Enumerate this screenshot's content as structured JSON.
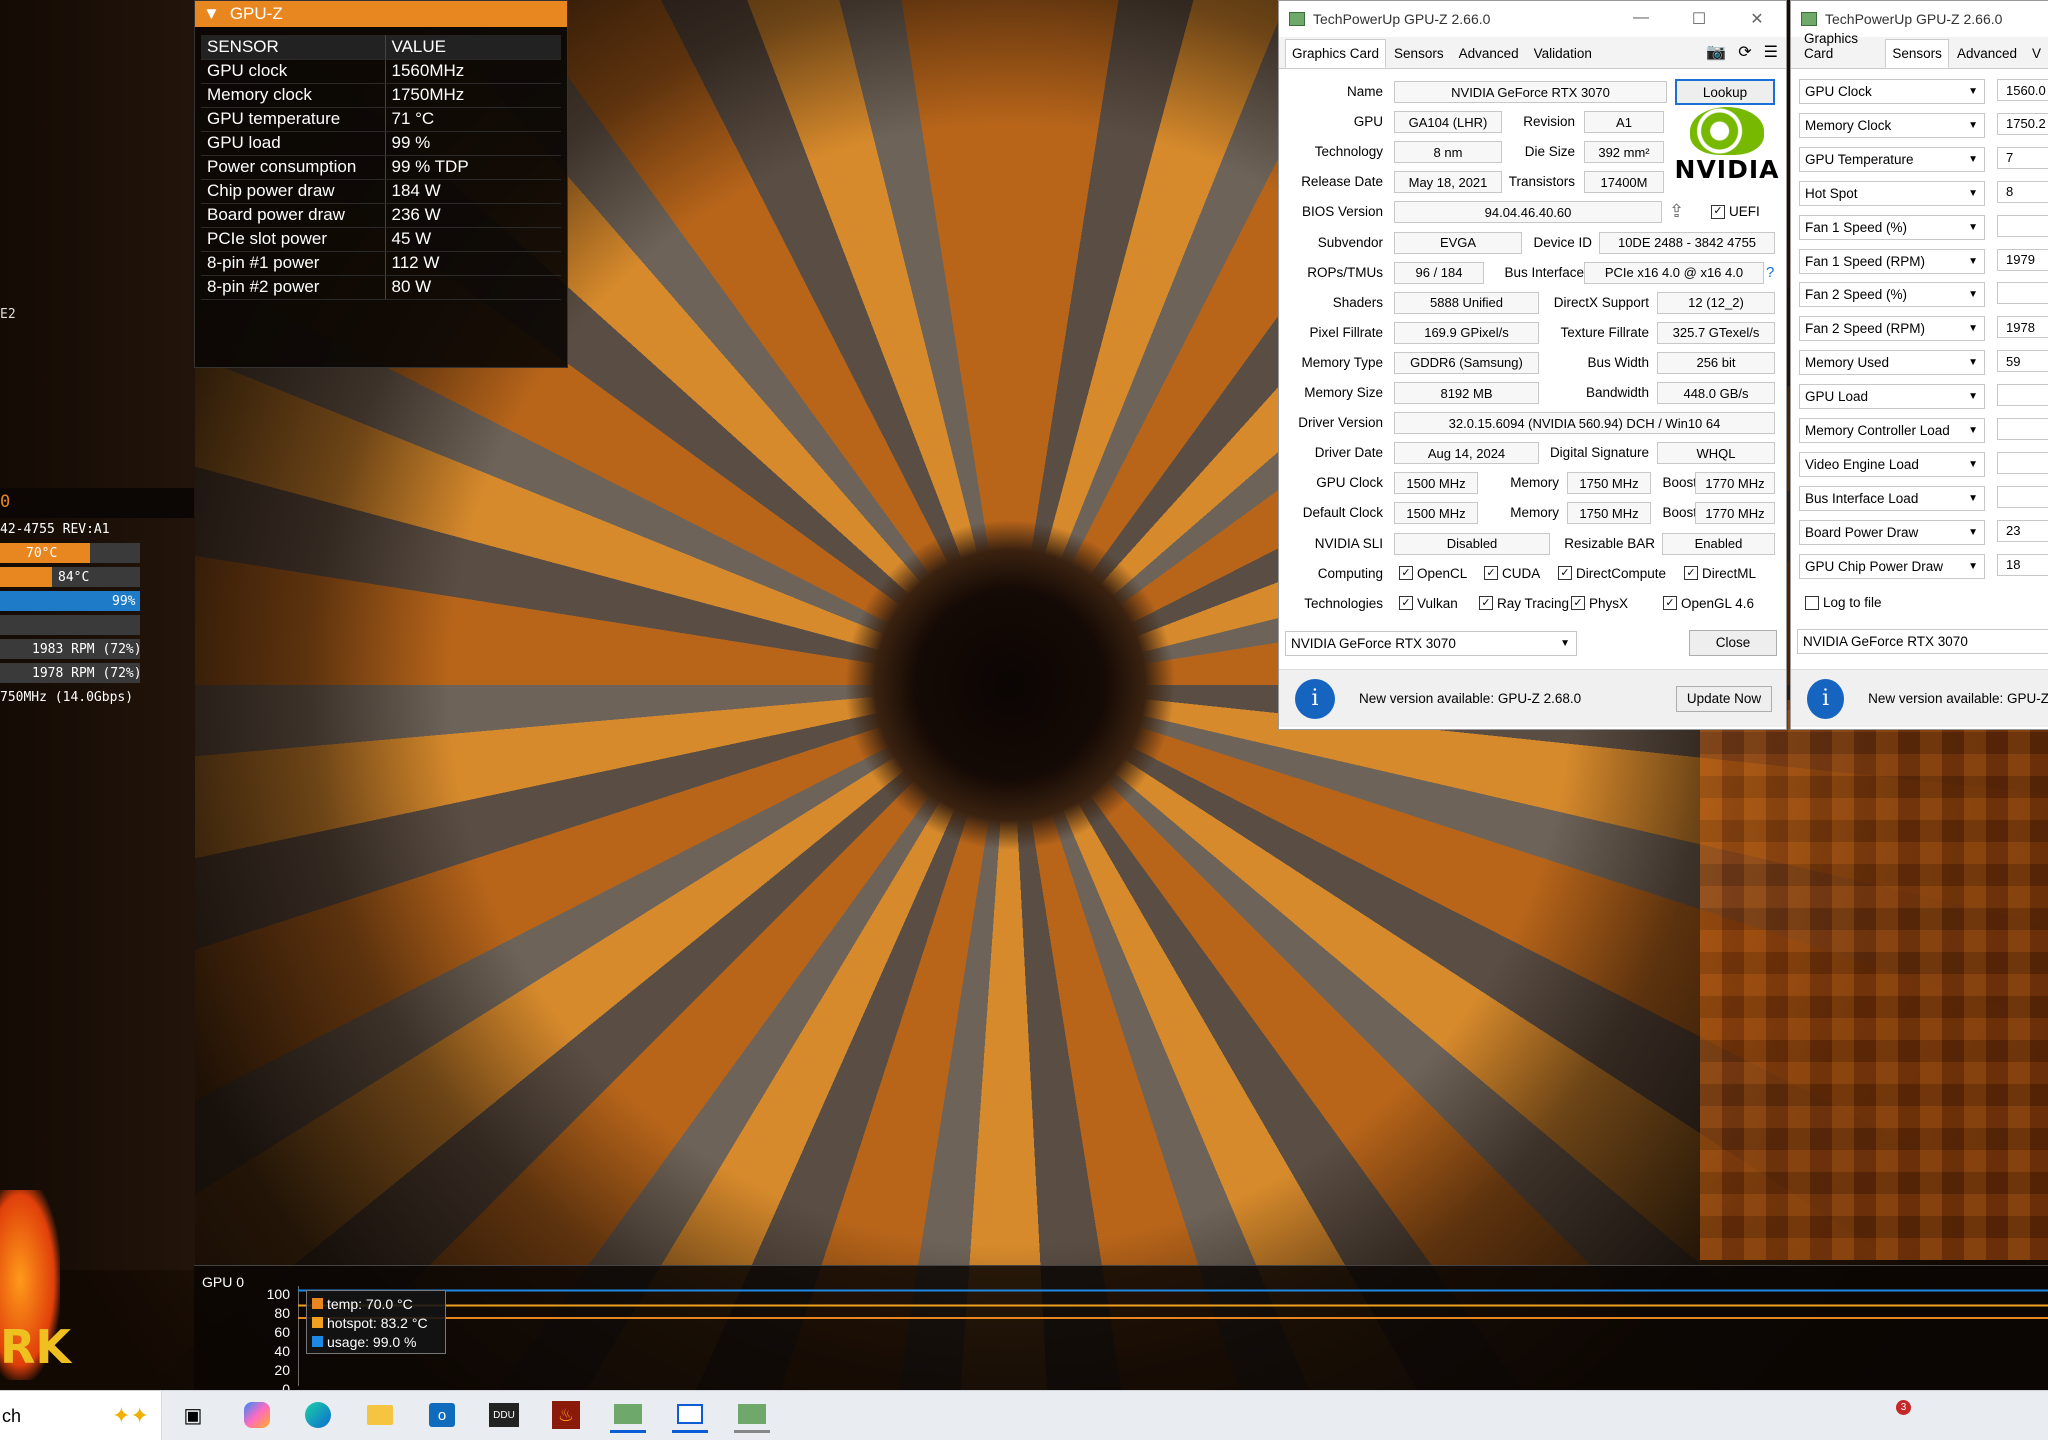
{
  "osd": {
    "title": "GPU-Z",
    "col_sensor": "SENSOR",
    "col_value": "VALUE",
    "rows": [
      {
        "sensor": "GPU clock",
        "value": "1560MHz"
      },
      {
        "sensor": "Memory clock",
        "value": "1750MHz"
      },
      {
        "sensor": "GPU temperature",
        "value": "71 °C"
      },
      {
        "sensor": "GPU load",
        "value": "99 %"
      },
      {
        "sensor": "Power consumption",
        "value": "99 % TDP"
      },
      {
        "sensor": "Chip power draw",
        "value": "184 W"
      },
      {
        "sensor": "Board power draw",
        "value": "236 W"
      },
      {
        "sensor": "PCIe slot power",
        "value": "45 W"
      },
      {
        "sensor": "8-pin #1 power",
        "value": "112 W"
      },
      {
        "sensor": "8-pin #2 power",
        "value": "80 W"
      }
    ]
  },
  "left_monitor": {
    "e2": "E2",
    "o": "0",
    "rev": "42-4755 REV:A1",
    "temp1": "70°C",
    "temp2": "84°C",
    "usage": "99%",
    "fan1": "1983 RPM (72%)",
    "fan2": "1978 RPM (72%)",
    "mem": "750MHz (14.0Gbps)",
    "bars": {
      "temp1": 0.64,
      "temp2": 0.37,
      "usage": 1.0
    }
  },
  "gpuz": {
    "title": "TechPowerUp GPU-Z 2.66.0",
    "tabs": [
      "Graphics Card",
      "Sensors",
      "Advanced",
      "Validation"
    ],
    "labels": {
      "name": "Name",
      "gpu": "GPU",
      "revision": "Revision",
      "technology": "Technology",
      "die_size": "Die Size",
      "release_date": "Release Date",
      "transistors": "Transistors",
      "bios": "BIOS Version",
      "uefi": "UEFI",
      "subvendor": "Subvendor",
      "device_id": "Device ID",
      "rops": "ROPs/TMUs",
      "bus_interface": "Bus Interface",
      "shaders": "Shaders",
      "directx": "DirectX Support",
      "pixel_fillrate": "Pixel Fillrate",
      "texture_fillrate": "Texture Fillrate",
      "memory_type": "Memory Type",
      "bus_width": "Bus Width",
      "memory_size": "Memory Size",
      "bandwidth": "Bandwidth",
      "driver_version": "Driver Version",
      "driver_date": "Driver Date",
      "digital_signature": "Digital Signature",
      "gpu_clock": "GPU Clock",
      "memory": "Memory",
      "boost": "Boost",
      "default_clock": "Default Clock",
      "sli": "NVIDIA SLI",
      "resizable_bar": "Resizable BAR",
      "computing": "Computing",
      "technologies": "Technologies"
    },
    "values": {
      "name": "NVIDIA GeForce RTX 3070",
      "gpu": "GA104 (LHR)",
      "revision": "A1",
      "technology": "8 nm",
      "die_size": "392 mm²",
      "release_date": "May 18, 2021",
      "transistors": "17400M",
      "bios": "94.04.46.40.60",
      "subvendor": "EVGA",
      "device_id": "10DE 2488 - 3842 4755",
      "rops": "96 / 184",
      "bus_interface": "PCIe x16 4.0 @ x16 4.0",
      "shaders": "5888 Unified",
      "directx": "12 (12_2)",
      "pixel_fillrate": "169.9 GPixel/s",
      "texture_fillrate": "325.7 GTexel/s",
      "memory_type": "GDDR6 (Samsung)",
      "bus_width": "256 bit",
      "memory_size": "8192 MB",
      "bandwidth": "448.0 GB/s",
      "driver_version": "32.0.15.6094 (NVIDIA 560.94) DCH / Win10 64",
      "driver_date": "Aug 14, 2024",
      "digital_signature": "WHQL",
      "gpu_clock": "1500 MHz",
      "gpu_memory": "1750 MHz",
      "gpu_boost": "1770 MHz",
      "default_clock": "1500 MHz",
      "default_memory": "1750 MHz",
      "default_boost": "1770 MHz",
      "sli": "Disabled",
      "resizable_bar": "Enabled"
    },
    "computing": [
      "OpenCL",
      "CUDA",
      "DirectCompute",
      "DirectML"
    ],
    "technologies": [
      "Vulkan",
      "Ray Tracing",
      "PhysX",
      "OpenGL 4.6"
    ],
    "lookup": "Lookup",
    "help": "?",
    "logo": "NVIDIA",
    "device_select": "NVIDIA GeForce RTX 3070",
    "close": "Close",
    "update_text": "New version available: GPU-Z 2.68.0",
    "update_button": "Update Now"
  },
  "sensors_win": {
    "title": "TechPowerUp GPU-Z 2.66.0",
    "tabs": [
      "Graphics Card",
      "Sensors",
      "Advanced",
      "V"
    ],
    "rows": [
      {
        "name": "GPU Clock",
        "value": "1560.0"
      },
      {
        "name": "Memory Clock",
        "value": "1750.2"
      },
      {
        "name": "GPU Temperature",
        "value": "7"
      },
      {
        "name": "Hot Spot",
        "value": "8"
      },
      {
        "name": "Fan 1 Speed (%)",
        "value": ""
      },
      {
        "name": "Fan 1 Speed (RPM)",
        "value": "1979"
      },
      {
        "name": "Fan 2 Speed (%)",
        "value": ""
      },
      {
        "name": "Fan 2 Speed (RPM)",
        "value": "1978"
      },
      {
        "name": "Memory Used",
        "value": "59"
      },
      {
        "name": "GPU Load",
        "value": ""
      },
      {
        "name": "Memory Controller Load",
        "value": ""
      },
      {
        "name": "Video Engine Load",
        "value": ""
      },
      {
        "name": "Bus Interface Load",
        "value": ""
      },
      {
        "name": "Board Power Draw",
        "value": "23"
      },
      {
        "name": "GPU Chip Power Draw",
        "value": "18"
      }
    ],
    "log_to_file": "Log to file",
    "device_select": "NVIDIA GeForce RTX 3070",
    "update_text": "New version available: GPU-Z"
  },
  "graph": {
    "label": "GPU 0",
    "ticks": [
      "100",
      "80",
      "60",
      "40",
      "20",
      "0"
    ],
    "legend": [
      {
        "text": "temp: 70.0 °C",
        "color": "#e8861f"
      },
      {
        "text": "hotspot: 83.2 °C",
        "color": "#f0a020"
      },
      {
        "text": "usage: 99.0 %",
        "color": "#1e88e5"
      }
    ],
    "series": {
      "usage": 99.0,
      "hotspot": 83.2,
      "temp": 70.0
    }
  },
  "taskbar": {
    "search": "ch",
    "badge": "3",
    "icons": [
      "copilot-icon",
      "task-view-icon",
      "copilot-app-icon",
      "edge-icon",
      "file-explorer-icon",
      "outlook-icon",
      "ddu-icon",
      "furmark-icon",
      "gpuz-icon",
      "window-icon",
      "gpuz-icon-2"
    ]
  },
  "furmark_logo": "RK"
}
